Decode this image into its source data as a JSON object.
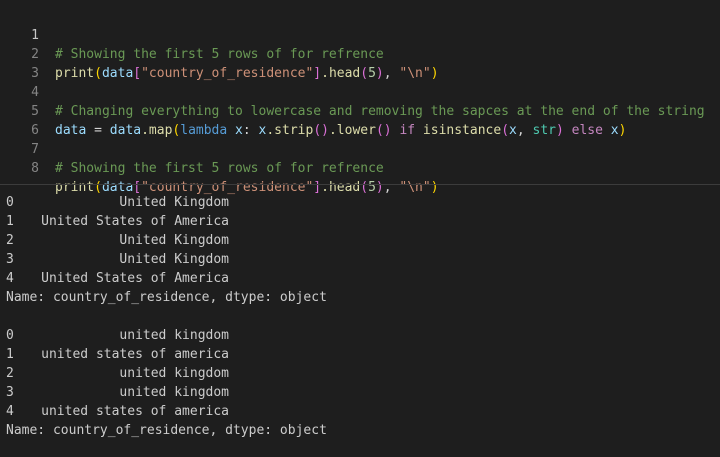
{
  "editor": {
    "lines": [
      {
        "number": "1",
        "comment": "# Showing the first 5 rows of for refrence"
      },
      {
        "number": "2",
        "fn": "print",
        "var": "data",
        "key": "\"country_of_residence\"",
        "method": ".head",
        "arg": "5",
        "sep": "\"\\n\""
      },
      {
        "number": "3"
      },
      {
        "number": "4",
        "comment": "# Changing everything to lowercase and removing the sapces at the end of the string"
      },
      {
        "number": "5",
        "lhs": "data",
        "eq": " = ",
        "obj": "data",
        "map": ".map",
        "lambda_kw": "lambda",
        "param": " x",
        "colon": ": ",
        "x1": "x",
        "strip": ".strip",
        "lower": ".lower",
        "if_kw": "if",
        "isinstance": "isinstance",
        "x2": "x",
        "str_type": "str",
        "else_kw": "else",
        "x3": "x"
      },
      {
        "number": "6"
      },
      {
        "number": "7",
        "comment": "# Showing the first 5 rows of for refrence"
      },
      {
        "number": "8",
        "fn": "print",
        "var": "data",
        "key": "\"country_of_residence\"",
        "method": ".head",
        "arg": "5",
        "sep": "\"\\n\""
      }
    ]
  },
  "output": {
    "blocks": [
      {
        "rows": [
          {
            "index": "0",
            "value": "United Kingdom"
          },
          {
            "index": "1",
            "value": "United States of America"
          },
          {
            "index": "2",
            "value": "United Kingdom"
          },
          {
            "index": "3",
            "value": "United Kingdom"
          },
          {
            "index": "4",
            "value": "United States of America"
          }
        ],
        "footer": "Name: country_of_residence, dtype: object"
      },
      {
        "rows": [
          {
            "index": "0",
            "value": "united kingdom"
          },
          {
            "index": "1",
            "value": "united states of america"
          },
          {
            "index": "2",
            "value": "united kingdom"
          },
          {
            "index": "3",
            "value": "united kingdom"
          },
          {
            "index": "4",
            "value": "united states of america"
          }
        ],
        "footer": "Name: country_of_residence, dtype: object"
      }
    ]
  }
}
